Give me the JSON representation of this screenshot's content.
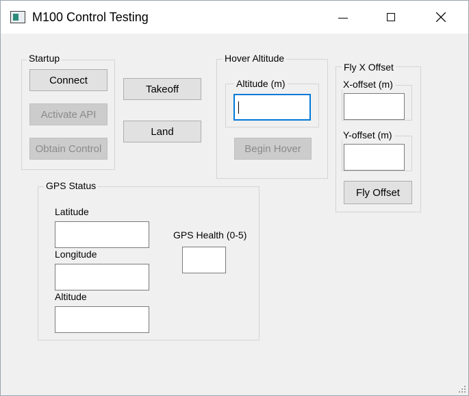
{
  "window": {
    "title": "M100 Control Testing",
    "icon": "app-window-icon",
    "controls": [
      "minimize-icon",
      "maximize-icon",
      "close-icon"
    ]
  },
  "startup": {
    "title": "Startup",
    "connect_label": "Connect",
    "activate_label": "Activate API",
    "obtain_label": "Obtain Control"
  },
  "actions": {
    "takeoff_label": "Takeoff",
    "land_label": "Land"
  },
  "hover": {
    "title": "Hover Altitude",
    "altitude_group_title": "Altitude (m)",
    "altitude_value": "",
    "begin_label": "Begin Hover"
  },
  "fly": {
    "title": "Fly X Offset",
    "x_group_title": "X-offset (m)",
    "x_value": "",
    "y_group_title": "Y-offset (m)",
    "y_value": "",
    "fly_label": "Fly Offset"
  },
  "gps": {
    "title": "GPS Status",
    "latitude_label": "Latitude",
    "latitude_value": "",
    "longitude_label": "Longitude",
    "longitude_value": "",
    "altitude_label": "Altitude",
    "altitude_value": "",
    "health_label": "GPS Health (0-5)",
    "health_value": ""
  },
  "colors": {
    "focus_border": "#0078d7",
    "window_bg": "#f0f0f0",
    "disabled_text": "#8a8a8a"
  }
}
